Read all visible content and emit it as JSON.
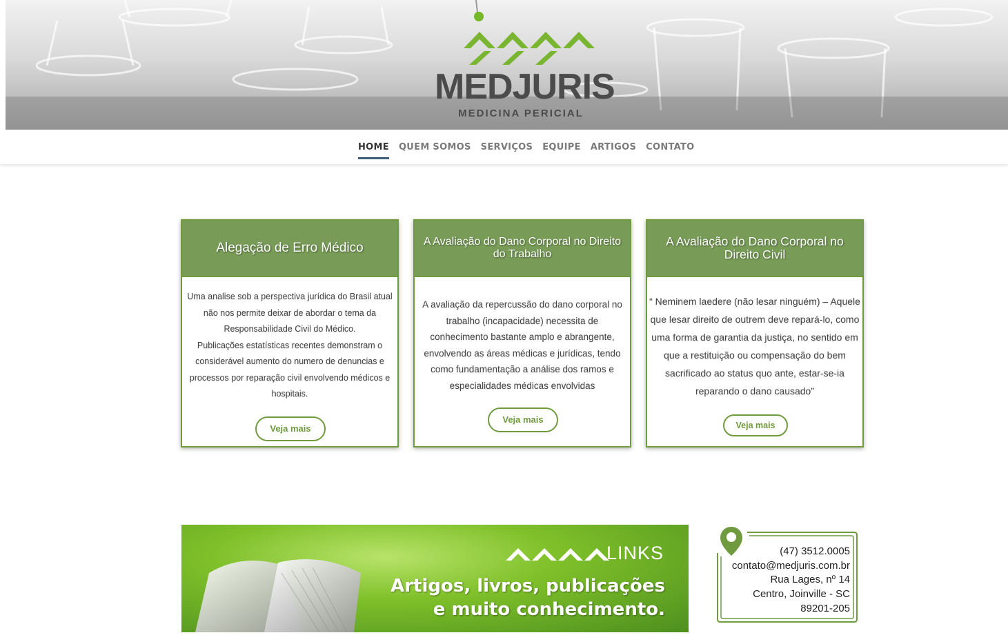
{
  "brand": {
    "name": "MEDJURIS",
    "tagline": "MEDICINA   PERICIAL"
  },
  "nav": {
    "items": [
      "HOME",
      "QUEM SOMOS",
      "SERVIÇOS",
      "EQUIPE",
      "ARTIGOS",
      "CONTATO"
    ],
    "active": "HOME"
  },
  "cards": [
    {
      "title": "Alegação de Erro Médico",
      "body": "Uma analise sob a perspectiva jurídica do Brasil atual não nos permite deixar de abordar o tema da Responsabilidade Civil do Médico.\nPublicações estatísticas recentes demonstram o considerável aumento do numero de denuncias e processos por reparação civil envolvendo médicos e hospitais.",
      "button": "Veja mais"
    },
    {
      "title": "A Avaliação do Dano Corporal no Direito do Trabalho",
      "body": "A avaliação da repercussão do dano corporal no trabalho (incapacidade) necessita de conhecimento bastante amplo e abrangente, envolvendo as áreas médicas e jurídicas, tendo como fundamentação a análise dos ramos e especialidades médicas envolvidas",
      "button": "Veja mais"
    },
    {
      "title": "A Avaliação do Dano Corporal no Direito Civil",
      "body": "“ Neminem laedere (não lesar ninguém) – Aquele que lesar direito de outrem deve repará-lo, como uma forma de garantia da justiça, no sentido em que a restituição ou compensação do bem sacrificado ao status quo ante, estar-se-ia reparando o dano causado”",
      "button": "Veja mais"
    }
  ],
  "links_banner": {
    "title": "LINKS",
    "line1": "Artigos, livros, publicações",
    "line2": "e muito conhecimento."
  },
  "contact": {
    "phone": "(47) 3512.0005",
    "email": "contato@medjuris.com.br",
    "street": "Rua Lages, nº 14",
    "city": "Centro, Joinville - SC",
    "zip": "89201-205"
  },
  "colors": {
    "brand_green": "#789c57",
    "border_green": "#6f9a3e",
    "nav_active_underline": "#3a5d79"
  }
}
